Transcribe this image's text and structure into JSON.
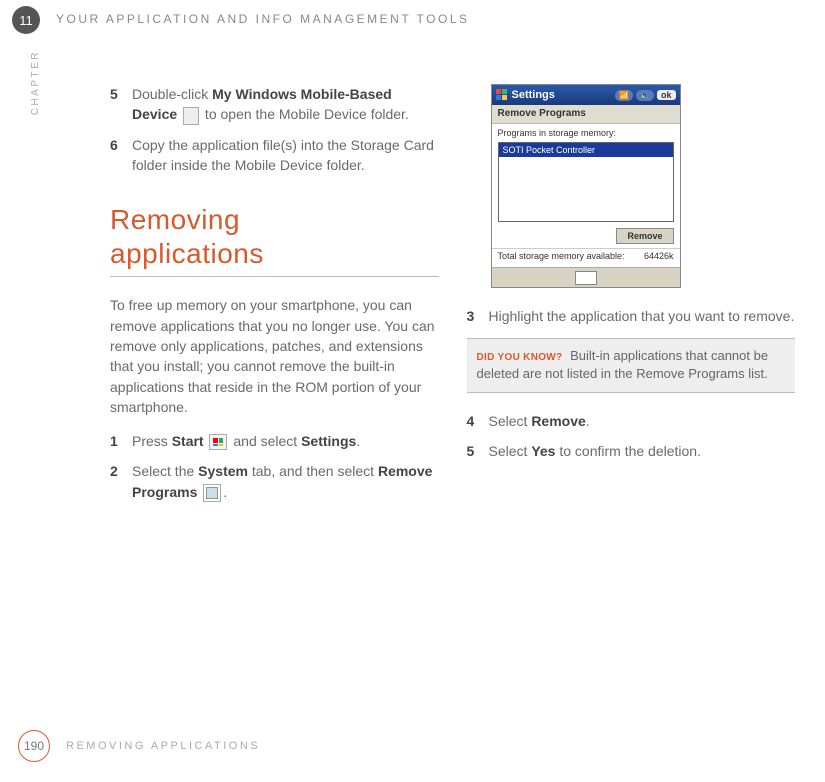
{
  "chapter_number": "11",
  "chapter_label": "CHAPTER",
  "header_title": "YOUR APPLICATION AND INFO MANAGEMENT TOOLS",
  "left": {
    "step5": {
      "num": "5",
      "before": "Double-click ",
      "bold": "My Windows Mobile-Based Device",
      "after": " to open the Mobile Device folder."
    },
    "step6": {
      "num": "6",
      "text": "Copy the application file(s) into the Storage Card folder inside the Mobile Device folder."
    },
    "heading_line1": "Removing",
    "heading_line2": "applications",
    "intro": "To free up memory on your smartphone, you can remove applications that you no longer use. You can remove only applications, patches, and extensions that you install; you cannot remove the built-in applications that reside in the ROM portion of your smartphone.",
    "step1": {
      "num": "1",
      "before": "Press ",
      "bold1": "Start",
      "mid": " and select ",
      "bold2": "Settings",
      "after": "."
    },
    "step2": {
      "num": "2",
      "before": "Select the ",
      "bold1": "System",
      "mid": " tab, and then select ",
      "bold2": "Remove Programs",
      "after": "."
    }
  },
  "screenshot": {
    "title": "Settings",
    "ok": "ok",
    "subtitle": "Remove Programs",
    "list_label": "Programs in storage memory:",
    "list_item": "SOTI Pocket Controller",
    "remove_btn": "Remove",
    "mem_label": "Total storage memory available:",
    "mem_value": "64426k"
  },
  "right": {
    "step3": {
      "num": "3",
      "text": "Highlight the application that you want to remove."
    },
    "dyk_label": "DID YOU KNOW?",
    "dyk_text": "Built-in applications that cannot be deleted are not listed in the Remove Programs list.",
    "step4": {
      "num": "4",
      "before": "Select ",
      "bold": "Remove",
      "after": "."
    },
    "step5": {
      "num": "5",
      "before": "Select ",
      "bold": "Yes",
      "after": " to confirm the deletion."
    }
  },
  "footer": {
    "page": "190",
    "title": "REMOVING APPLICATIONS"
  }
}
